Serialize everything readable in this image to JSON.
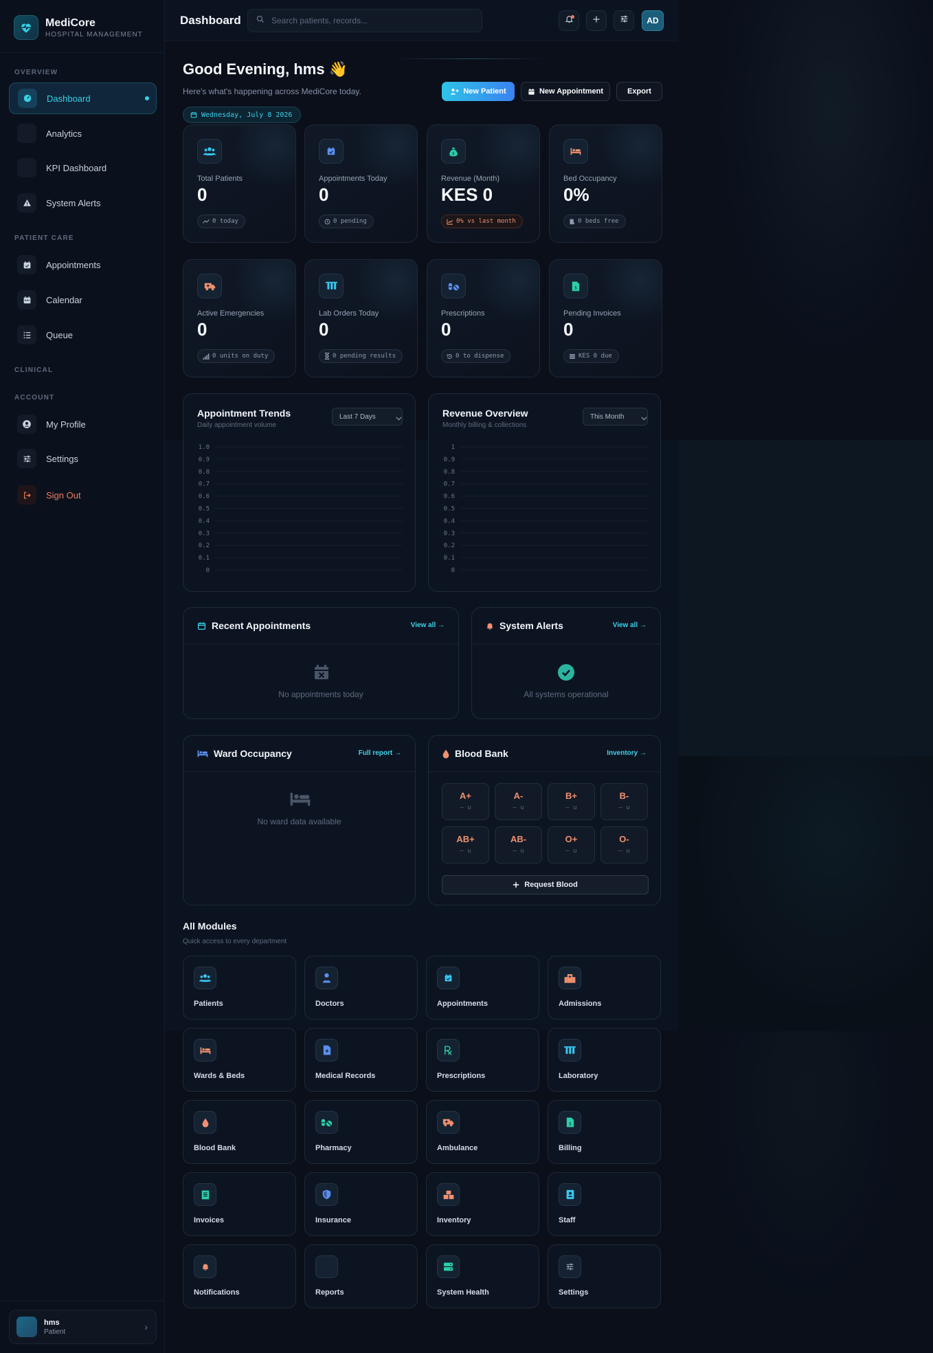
{
  "brand": {
    "name": "MediCore",
    "tagline": "HOSPITAL MANAGEMENT"
  },
  "sidebar": {
    "sections": {
      "overview": "OVERVIEW",
      "patient_care": "PATIENT CARE",
      "clinical": "CLINICAL",
      "account": "ACCOUNT"
    },
    "items": [
      {
        "label": "Dashboard",
        "active": true
      },
      {
        "label": "Analytics"
      },
      {
        "label": "KPI Dashboard"
      },
      {
        "label": "System Alerts"
      },
      {
        "label": "Appointments"
      },
      {
        "label": "Calendar"
      },
      {
        "label": "Queue"
      },
      {
        "label": "My Profile"
      },
      {
        "label": "Settings"
      },
      {
        "label": "Sign Out"
      }
    ],
    "user": {
      "name": "hms",
      "role": "Patient"
    }
  },
  "topbar": {
    "title": "Dashboard",
    "search_placeholder": "Search patients, records...",
    "avatar": "AD"
  },
  "greeting": {
    "title": "Good Evening, hms 👋",
    "subtitle": "Here's what's happening across MediCore today.",
    "date": "Wednesday, July 8 2026"
  },
  "actions": {
    "new_patient": "New Patient",
    "new_appointment": "New Appointment",
    "export": "Export"
  },
  "stats": [
    {
      "label": "Total Patients",
      "value": "0",
      "chip": "0 today"
    },
    {
      "label": "Appointments Today",
      "value": "0",
      "chip": "0 pending"
    },
    {
      "label": "Revenue (Month)",
      "value": "KES 0",
      "chip": "0% vs last month"
    },
    {
      "label": "Bed Occupancy",
      "value": "0%",
      "chip": "0 beds free"
    },
    {
      "label": "Active Emergencies",
      "value": "0",
      "chip": "0 units on duty"
    },
    {
      "label": "Lab Orders Today",
      "value": "0",
      "chip": "0 pending results"
    },
    {
      "label": "Prescriptions",
      "value": "0",
      "chip": "0 to dispense"
    },
    {
      "label": "Pending Invoices",
      "value": "0",
      "chip": "KES 0 due"
    }
  ],
  "charts": {
    "appointments": {
      "title": "Appointment Trends",
      "subtitle": "Daily appointment volume",
      "filter": "Last 7 Days"
    },
    "revenue": {
      "title": "Revenue Overview",
      "subtitle": "Monthly billing & collections",
      "filter": "This Month"
    }
  },
  "chart_data": [
    {
      "type": "line",
      "title": "Appointment Trends",
      "x": [],
      "series": [],
      "ylim": [
        0,
        1
      ],
      "yticks": [
        "1.0",
        "0.9",
        "0.8",
        "0.7",
        "0.6",
        "0.5",
        "0.4",
        "0.3",
        "0.2",
        "0.1",
        "0"
      ],
      "grid": true
    },
    {
      "type": "line",
      "title": "Revenue Overview",
      "x": [],
      "series": [],
      "ylim": [
        0,
        1
      ],
      "yticks": [
        "1",
        "0.9",
        "0.8",
        "0.7",
        "0.6",
        "0.5",
        "0.4",
        "0.3",
        "0.2",
        "0.1",
        "0"
      ],
      "grid": true
    }
  ],
  "panels": {
    "recent_appointments": {
      "title": "Recent Appointments",
      "link": "View all →",
      "empty": "No appointments today"
    },
    "system_alerts": {
      "title": "System Alerts",
      "link": "View all →",
      "empty": "All systems operational"
    },
    "ward_occupancy": {
      "title": "Ward Occupancy",
      "link": "Full report →",
      "empty": "No ward data available"
    },
    "blood_bank": {
      "title": "Blood Bank",
      "link": "Inventory →",
      "types": [
        {
          "type": "A+",
          "units": "— u"
        },
        {
          "type": "A-",
          "units": "— u"
        },
        {
          "type": "B+",
          "units": "— u"
        },
        {
          "type": "B-",
          "units": "— u"
        },
        {
          "type": "AB+",
          "units": "— u"
        },
        {
          "type": "AB-",
          "units": "— u"
        },
        {
          "type": "O+",
          "units": "— u"
        },
        {
          "type": "O-",
          "units": "— u"
        }
      ],
      "request": "Request Blood"
    }
  },
  "modules": {
    "title": "All Modules",
    "subtitle": "Quick access to every department",
    "items": [
      {
        "label": "Patients"
      },
      {
        "label": "Doctors"
      },
      {
        "label": "Appointments"
      },
      {
        "label": "Admissions"
      },
      {
        "label": "Wards & Beds"
      },
      {
        "label": "Medical Records"
      },
      {
        "label": "Prescriptions"
      },
      {
        "label": "Laboratory"
      },
      {
        "label": "Blood Bank"
      },
      {
        "label": "Pharmacy"
      },
      {
        "label": "Ambulance"
      },
      {
        "label": "Billing"
      },
      {
        "label": "Invoices"
      },
      {
        "label": "Insurance"
      },
      {
        "label": "Inventory"
      },
      {
        "label": "Staff"
      },
      {
        "label": "Notifications"
      },
      {
        "label": "Reports"
      },
      {
        "label": "System Health"
      },
      {
        "label": "Settings"
      }
    ]
  },
  "colors": {
    "accent": "#38d0e6",
    "warn": "#f07d5f",
    "blue": "#3b82f0",
    "bg": "#0a0f1a"
  }
}
